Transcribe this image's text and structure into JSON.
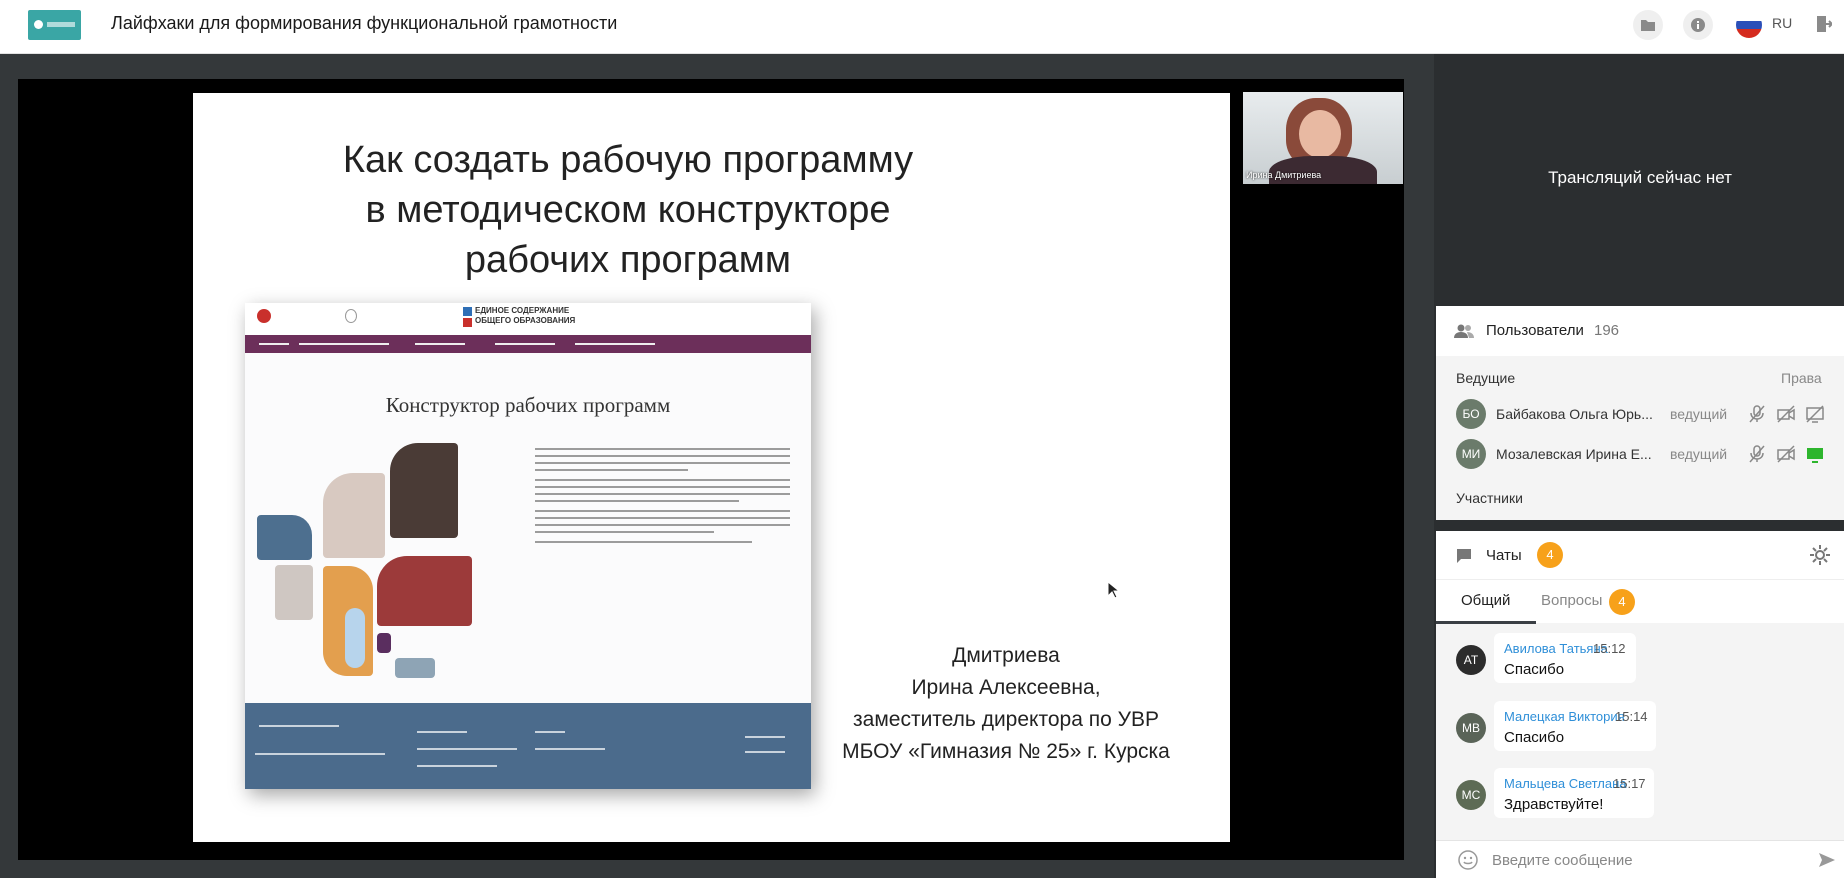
{
  "header": {
    "title": "Лайфхаки для формирования функциональной грамотности",
    "lang": "RU"
  },
  "slide": {
    "title_lines": [
      "Как создать рабочую программу",
      "в методическом конструкторе",
      "рабочих программ"
    ],
    "mini_heading": "Конструктор рабочих программ",
    "brand_text": "ЕДИНОЕ СОДЕРЖАНИЕ ОБЩЕГО ОБРАЗОВАНИЯ",
    "presenter_lines": [
      "Дмитриева",
      "Ирина Алексеевна,",
      "заместитель директора по УВР",
      "МБОУ «Гимназия № 25» г. Курска"
    ]
  },
  "camera": {
    "name": "Ирина Дмитриева"
  },
  "broadcast": {
    "status": "Трансляций сейчас нет"
  },
  "users": {
    "label": "Пользователи",
    "count": "196",
    "hosts_label": "Ведущие",
    "rights_label": "Права",
    "participants_label": "Участники",
    "hosts": [
      {
        "initials": "БО",
        "name": "Байбакова Ольга Юрь...",
        "role": "ведущий"
      },
      {
        "initials": "МИ",
        "name": "Мозалевская Ирина Е...",
        "role": "ведущий"
      }
    ]
  },
  "chat": {
    "label": "Чаты",
    "badge": "4",
    "tabs": [
      {
        "label": "Общий",
        "badge": ""
      },
      {
        "label": "Вопросы",
        "badge": "4"
      }
    ],
    "messages": [
      {
        "initials": "АТ",
        "author": "Авилова Татьяна",
        "time": "15:12",
        "text": "Спасибо",
        "color": "#2c2c2c"
      },
      {
        "initials": "МВ",
        "author": "Малецкая Виктория",
        "time": "15:14",
        "text": "Спасибо",
        "color": "#5a6458"
      },
      {
        "initials": "МС",
        "author": "Мальцева Светлана",
        "time": "15:17",
        "text": "Здравствуйте!",
        "color": "#5d6b55"
      }
    ],
    "input_placeholder": "Введите сообщение"
  },
  "colors": {
    "accent": "#f7a11a",
    "link": "#2f8fd8",
    "brand_nav": "#6c2f5a",
    "logo": "#3aa6a5"
  }
}
